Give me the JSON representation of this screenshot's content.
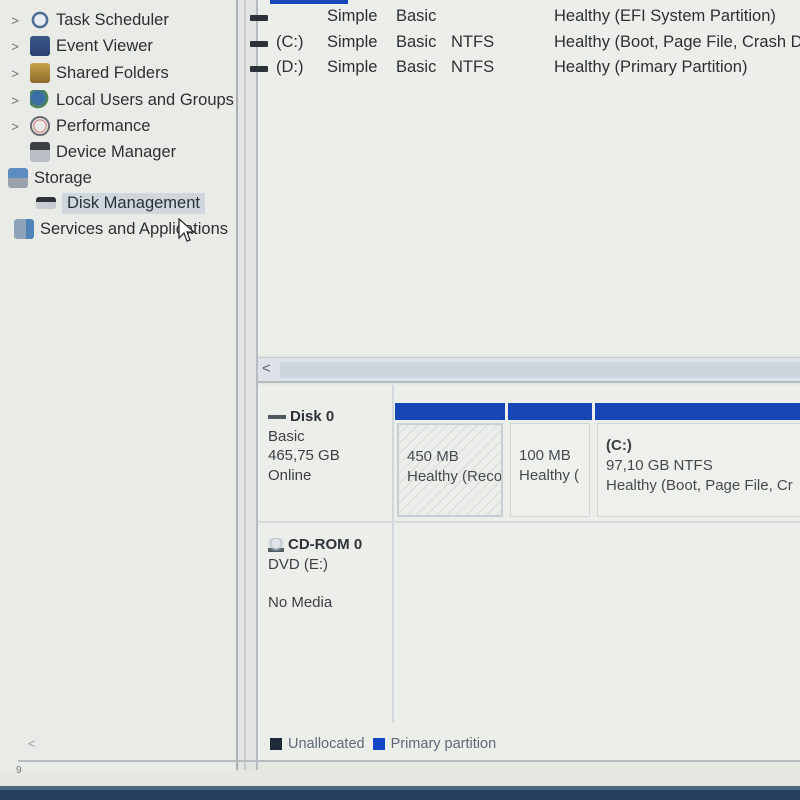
{
  "tree": {
    "items": [
      {
        "label": "Task Scheduler",
        "icon": "clock-icon",
        "expandable": true,
        "level": 1
      },
      {
        "label": "Event Viewer",
        "icon": "event-log-icon",
        "expandable": true,
        "level": 1
      },
      {
        "label": "Shared Folders",
        "icon": "shared-folder-icon",
        "expandable": true,
        "level": 1
      },
      {
        "label": "Local Users and Groups",
        "icon": "users-icon",
        "expandable": true,
        "level": 1
      },
      {
        "label": "Performance",
        "icon": "performance-icon",
        "expandable": true,
        "level": 1
      },
      {
        "label": "Device Manager",
        "icon": "device-manager-icon",
        "expandable": false,
        "level": 1
      },
      {
        "label": "Storage",
        "icon": "storage-icon",
        "expandable": false,
        "level": 0
      },
      {
        "label": "Disk Management",
        "icon": "disk-icon",
        "expandable": false,
        "level": 1,
        "selected": true
      },
      {
        "label": "Services and Applications",
        "icon": "services-icon",
        "expandable": false,
        "level": 0
      }
    ],
    "scroll_left": "<",
    "scroll_right": ">",
    "chevron": ">"
  },
  "volumes": {
    "rows": [
      {
        "volume": "",
        "layout": "Simple",
        "type": "Basic",
        "fs": "",
        "status": "Healthy (EFI System Partition)"
      },
      {
        "volume": "(C:)",
        "layout": "Simple",
        "type": "Basic",
        "fs": "NTFS",
        "status": "Healthy (Boot, Page File, Crash D"
      },
      {
        "volume": "(D:)",
        "layout": "Simple",
        "type": "Basic",
        "fs": "NTFS",
        "status": "Healthy (Primary Partition)"
      }
    ],
    "scroll_left": "<"
  },
  "disks": [
    {
      "name": "Disk 0",
      "type": "Basic",
      "size": "465,75 GB",
      "state": "Online",
      "partitions": [
        {
          "drive": "",
          "size": "450 MB",
          "status": "Healthy (Reco",
          "hatched": true
        },
        {
          "drive": "",
          "size": "100 MB",
          "status": "Healthy (",
          "hatched": false
        },
        {
          "drive": "(C:)",
          "size": "97,10 GB NTFS",
          "status": "Healthy (Boot, Page File, Cr",
          "hatched": false
        }
      ]
    },
    {
      "name": "CD-ROM 0",
      "type": "DVD (E:)",
      "state": "No Media"
    }
  ],
  "legend": [
    {
      "label": "Unallocated",
      "color": "#1e2a3a"
    },
    {
      "label": "Primary partition",
      "color": "#1646c8"
    }
  ],
  "colors": {
    "partition_header": "#1646b4",
    "selection": "#cfd6de"
  },
  "corner_glyph": "9"
}
